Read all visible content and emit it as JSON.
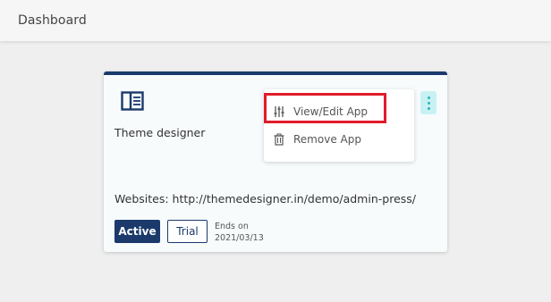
{
  "header": {
    "title": "Dashboard"
  },
  "card": {
    "app_name": "Theme designer",
    "app_icon": "panel-layout-icon",
    "menu": {
      "items": [
        {
          "label": "View/Edit App",
          "icon": "sliders-icon"
        },
        {
          "label": "Remove App",
          "icon": "trash-icon"
        }
      ]
    },
    "websites": "Websites: http://themedesigner.in/demo/admin-press/",
    "status": "Active",
    "plan": "Trial",
    "ends_label": "Ends on",
    "ends_date": "2021/03/13",
    "colors": {
      "accent": "#1b3a6b",
      "highlight": "#e21b2b",
      "kebab_bg": "#c8f1f3"
    }
  }
}
